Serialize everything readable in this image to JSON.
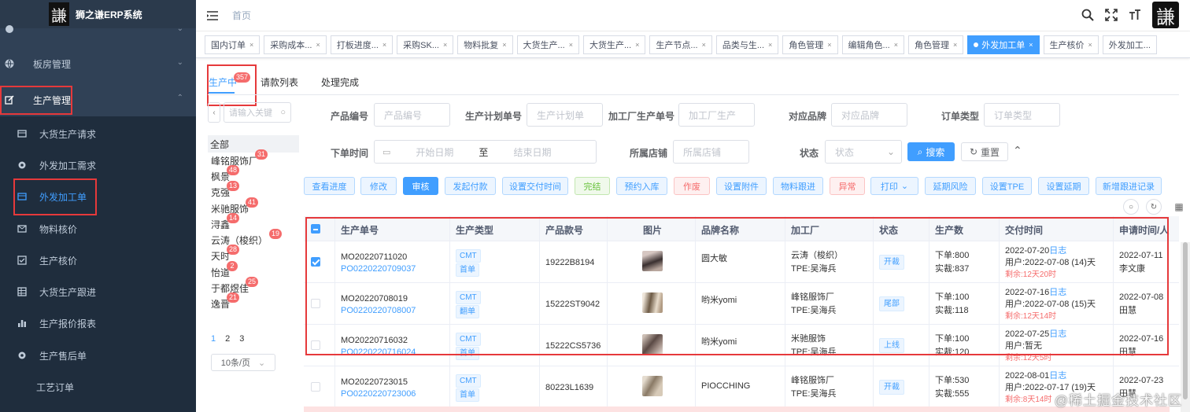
{
  "app": {
    "logo_char": "謙",
    "title": "狮之谦ERP系统"
  },
  "sidebar": {
    "items": [
      {
        "label": "",
        "icon": "circle-icon"
      },
      {
        "label": "板房管理",
        "icon": "globe-icon"
      },
      {
        "label": "生产管理",
        "icon": "edit-icon"
      },
      {
        "label": "大货生产请求",
        "icon": "card-icon"
      },
      {
        "label": "外发加工需求",
        "icon": "gear-icon"
      },
      {
        "label": "外发加工单",
        "icon": "card-icon"
      },
      {
        "label": "物料核价",
        "icon": "mail-icon"
      },
      {
        "label": "生产核价",
        "icon": "check-square-icon"
      },
      {
        "label": "大货生产跟进",
        "icon": "grid-icon"
      },
      {
        "label": "生产报价报表",
        "icon": "bar-chart-icon"
      },
      {
        "label": "生产售后单",
        "icon": "gear-icon"
      },
      {
        "label": "工艺订单",
        "icon": ""
      }
    ]
  },
  "navbar": {
    "breadcrumb": "首页",
    "avatar_char": "謙"
  },
  "tags": [
    {
      "label": "国内订单"
    },
    {
      "label": "采购成本..."
    },
    {
      "label": "打板进度..."
    },
    {
      "label": "采购SK..."
    },
    {
      "label": "物料批复"
    },
    {
      "label": "大货生产..."
    },
    {
      "label": "大货生产..."
    },
    {
      "label": "生产节点..."
    },
    {
      "label": "品类与生..."
    },
    {
      "label": "角色管理"
    },
    {
      "label": "编辑角色..."
    },
    {
      "label": "角色管理"
    },
    {
      "label": "外发加工单"
    },
    {
      "label": "生产核价"
    },
    {
      "label": "外发加工..."
    }
  ],
  "tabs": [
    {
      "label": "生产中",
      "badge": "357"
    },
    {
      "label": "请款列表"
    },
    {
      "label": "处理完成"
    }
  ],
  "left_filter": {
    "search_placeholder": "请输入关键",
    "all_label": "全部",
    "vendors": [
      {
        "name": "峰铭服饰厂",
        "count": "31"
      },
      {
        "name": "枫景",
        "count": "48"
      },
      {
        "name": "克强",
        "count": "13"
      },
      {
        "name": "米驰服饰",
        "count": "41"
      },
      {
        "name": "浔鑫",
        "count": "14"
      },
      {
        "name": "云涛（梭织）",
        "count": "19"
      },
      {
        "name": "天时",
        "count": "28"
      },
      {
        "name": "怡道",
        "count": "2"
      },
      {
        "name": "于都煜佳",
        "count": "25"
      },
      {
        "name": "逸晋",
        "count": "21"
      }
    ],
    "pages": [
      "1",
      "2",
      "3"
    ],
    "page_size": "10条/页"
  },
  "filters": {
    "product_no": {
      "label": "产品编号",
      "placeholder": "产品编号"
    },
    "plan_no": {
      "label": "生产计划单号",
      "placeholder": "生产计划单"
    },
    "factory_no": {
      "label": "加工厂生产单号",
      "placeholder": "加工厂生产"
    },
    "brand": {
      "label": "对应品牌",
      "placeholder": "对应品牌"
    },
    "order_type": {
      "label": "订单类型",
      "placeholder": "订单类型"
    },
    "date": {
      "label": "下单时间",
      "start": "开始日期",
      "sep": "至",
      "end": "结束日期"
    },
    "store": {
      "label": "所属店铺",
      "placeholder": "所属店铺"
    },
    "status": {
      "label": "状态",
      "placeholder": "状态"
    },
    "search_btn": "搜索",
    "reset_btn": "重置"
  },
  "actions": [
    "查看进度",
    "修改",
    "审核",
    "发起付款",
    "设置交付时间",
    "完结",
    "预约入库",
    "作废",
    "设置附件",
    "物料跟进",
    "异常",
    "打印",
    "延期风险",
    "设置TPE",
    "设置延期",
    "新增跟进记录"
  ],
  "table": {
    "headers": [
      "生产单号",
      "生产类型",
      "产品款号",
      "图片",
      "品牌名称",
      "加工厂",
      "状态",
      "生产数",
      "交付时间",
      "申请时间/人"
    ],
    "rows": [
      {
        "mo": "MO20220711020",
        "po": "PO0220220709037",
        "type1": "CMT",
        "type2": "首单",
        "sku": "19222B8194",
        "brand": "圆大敏",
        "factory": "云涛（梭织）",
        "tpe": "TPE:吴海兵",
        "status": "开裁",
        "qty_order": "下单:800",
        "qty_actual": "实裁:837",
        "deliver": "2022-07-20",
        "log": "日志",
        "user": "用户:2022-07-08 (14)天",
        "remain": "剩余:12天20时",
        "apply_date": "2022-07-11",
        "apply_user": "李文康",
        "checked": true
      },
      {
        "mo": "MO20220708019",
        "po": "PO0220220708007",
        "type1": "CMT",
        "type2": "翻单",
        "sku": "15222ST9042",
        "brand": "哟米yomi",
        "factory": "峰铭服饰厂",
        "tpe": "TPE:吴海兵",
        "status": "尾部",
        "qty_order": "下单:100",
        "qty_actual": "实裁:118",
        "deliver": "2022-07-16",
        "log": "日志",
        "user": "用户:2022-07-08 (15)天",
        "remain": "剩余:12天14时",
        "apply_date": "2022-07-08",
        "apply_user": "田慧",
        "checked": false
      },
      {
        "mo": "MO20220716032",
        "po": "PO0220220716024",
        "type1": "CMT",
        "type2": "首单",
        "sku": "15222CS5736",
        "brand": "哟米yomi",
        "factory": "米驰服饰",
        "tpe": "TPE:吴海兵",
        "status": "上线",
        "qty_order": "下单:100",
        "qty_actual": "实裁:120",
        "deliver": "2022-07-25",
        "log": "日志",
        "user": "用户:暂无",
        "remain": "剩余:12天5时",
        "apply_date": "2022-07-16",
        "apply_user": "田慧",
        "checked": false
      },
      {
        "mo": "MO20220723015",
        "po": "PO0220220723006",
        "type1": "CMT",
        "type2": "首单",
        "sku": "80223L1639",
        "brand": "PIOCCHING",
        "factory": "峰铭服饰厂",
        "tpe": "TPE:吴海兵",
        "status": "开裁",
        "qty_order": "下单:530",
        "qty_actual": "实裁:555",
        "deliver": "2022-08-01",
        "log": "日志",
        "user": "用户:2022-07-17 (19)天",
        "remain": "剩余:8天14时",
        "apply_date": "2022-07-23",
        "apply_user": "田慧",
        "checked": false
      }
    ]
  },
  "watermark": "@稀土掘金技术社区",
  "colors": {
    "sidebar_bg": "#304156",
    "primary": "#409eff",
    "danger": "#f56c6c",
    "highlight_box": "#e6393b"
  }
}
